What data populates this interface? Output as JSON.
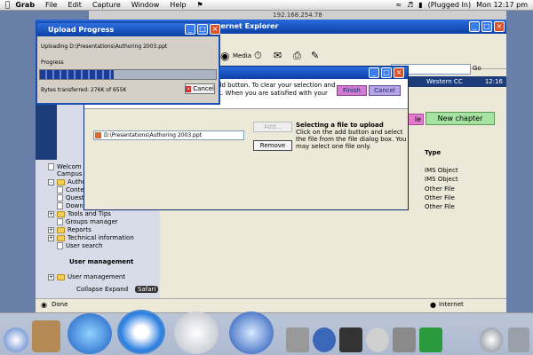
{
  "menubar": {
    "app": "Grab",
    "items": [
      "File",
      "Edit",
      "Capture",
      "Window",
      "Help"
    ],
    "battery": "(Plugged In)",
    "clock": "Mon 12:17 pm"
  },
  "remote_title": "192.168.254.78",
  "ie": {
    "title": "Internet Explorer",
    "media": "Media",
    "go": "Go",
    "status": "Done",
    "zone": "Internet"
  },
  "upload": {
    "title": "Upload Progress",
    "uploading": "Uploading D:\\Presentations\\Authoring 2003.ppt",
    "progress_label": "Progress",
    "progress_fraction": 0.42,
    "bytes_label": "Bytes transferred:",
    "bytes_value": "276K of 655K",
    "cancel": "Cancel"
  },
  "select_dialog": {
    "instructions_line1": "dd button. To clear your selection and",
    "instructions_line2": "k. When you are satisfied with your",
    "finish": "Finish",
    "cancel": "Cancel",
    "file_path": "D:\\Presentations\\Authoring 2003.ppt",
    "add": "Add...",
    "remove": "Remove",
    "info_title": "Selecting a file to upload",
    "info_text": "Click on the add button and select the file from the file dialog box. You may select one file only."
  },
  "app": {
    "westbar": "Western CC",
    "time": "12:16",
    "new_chapter": "New chapter",
    "chip": "le",
    "type_header": "Type",
    "type_left_header": "l",
    "types": [
      "IMS Object",
      "IMS Object",
      "Other File",
      "Other File",
      "Other File"
    ],
    "nav": [
      {
        "label": "Welcom",
        "kind": "plain"
      },
      {
        "label": "Campus",
        "kind": "plain"
      },
      {
        "label": "Authoring",
        "kind": "folder"
      },
      {
        "label": "Conte",
        "kind": "doc"
      },
      {
        "label": "Quest",
        "kind": "doc"
      },
      {
        "label": "Downl",
        "kind": "doc"
      },
      {
        "label": "Tools and Tips",
        "kind": "folder"
      },
      {
        "label": "Groups manager",
        "kind": "doc"
      },
      {
        "label": "Reports",
        "kind": "folder"
      },
      {
        "label": "Technical information",
        "kind": "folder"
      },
      {
        "label": "User search",
        "kind": "doc"
      }
    ],
    "user_mgmt_heading": "User management",
    "user_mgmt_item": "User management",
    "collapse": "Collapse",
    "expand": "Expand",
    "safari_label": "Safari"
  },
  "colors": {
    "xp_title": "#0a3fa6",
    "finish": "#d37bd3",
    "new_chapter": "#a6e3a2"
  }
}
